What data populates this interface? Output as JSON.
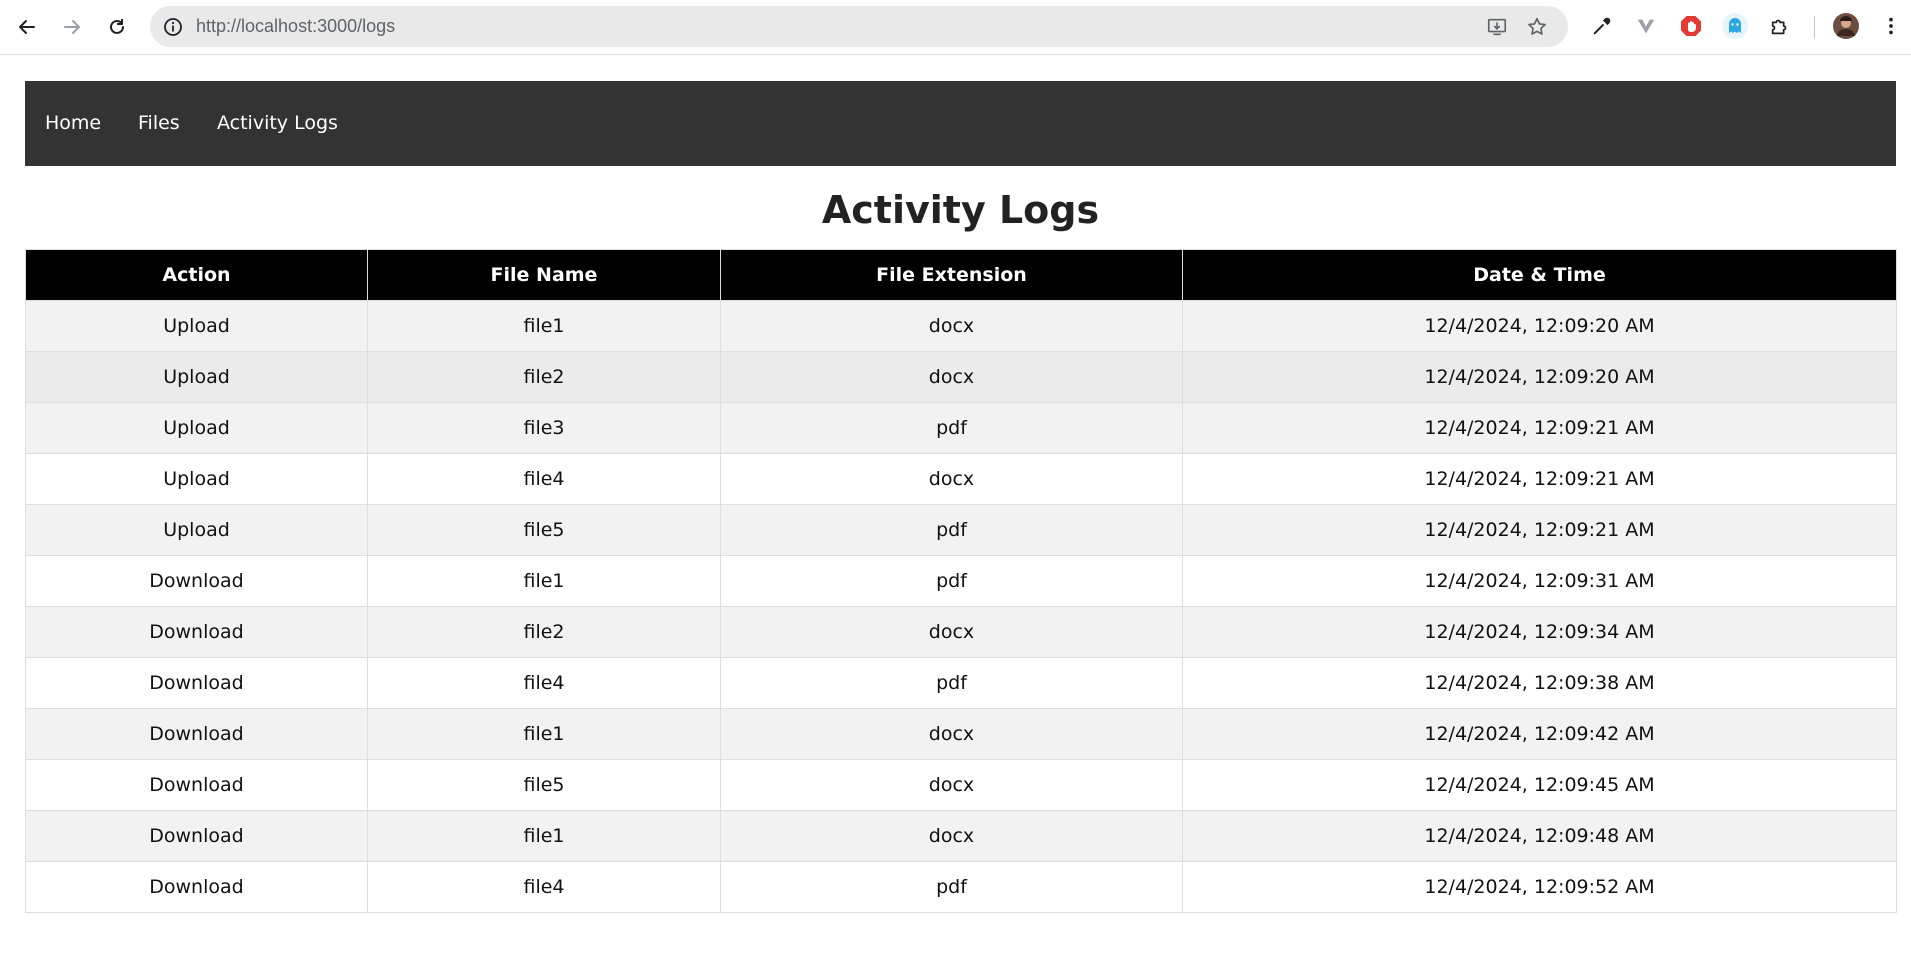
{
  "browser": {
    "url": "http://localhost:3000/logs",
    "icons": [
      "back-arrow-icon",
      "forward-arrow-icon",
      "reload-icon",
      "site-info-icon",
      "install-app-icon",
      "bookmark-star-icon",
      "eyedropper-icon",
      "extension-v-icon",
      "adblock-icon",
      "ghost-extension-icon",
      "extensions-puzzle-icon",
      "profile-avatar",
      "more-menu-icon"
    ]
  },
  "nav": {
    "items": [
      {
        "label": "Home"
      },
      {
        "label": "Files"
      },
      {
        "label": "Activity Logs"
      }
    ]
  },
  "page": {
    "title": "Activity Logs"
  },
  "table": {
    "headers": [
      "Action",
      "File Name",
      "File Extension",
      "Date & Time"
    ],
    "rows": [
      [
        "Upload",
        "file1",
        "docx",
        "12/4/2024, 12:09:20 AM"
      ],
      [
        "Upload",
        "file2",
        "docx",
        "12/4/2024, 12:09:20 AM"
      ],
      [
        "Upload",
        "file3",
        "pdf",
        "12/4/2024, 12:09:21 AM"
      ],
      [
        "Upload",
        "file4",
        "docx",
        "12/4/2024, 12:09:21 AM"
      ],
      [
        "Upload",
        "file5",
        "pdf",
        "12/4/2024, 12:09:21 AM"
      ],
      [
        "Download",
        "file1",
        "pdf",
        "12/4/2024, 12:09:31 AM"
      ],
      [
        "Download",
        "file2",
        "docx",
        "12/4/2024, 12:09:34 AM"
      ],
      [
        "Download",
        "file4",
        "pdf",
        "12/4/2024, 12:09:38 AM"
      ],
      [
        "Download",
        "file1",
        "docx",
        "12/4/2024, 12:09:42 AM"
      ],
      [
        "Download",
        "file5",
        "docx",
        "12/4/2024, 12:09:45 AM"
      ],
      [
        "Download",
        "file1",
        "docx",
        "12/4/2024, 12:09:48 AM"
      ],
      [
        "Download",
        "file4",
        "pdf",
        "12/4/2024, 12:09:52 AM"
      ]
    ]
  },
  "colors": {
    "nav_bg": "#333333",
    "header_bg": "#000000",
    "row_alt_bg": "#f2f2f2"
  }
}
